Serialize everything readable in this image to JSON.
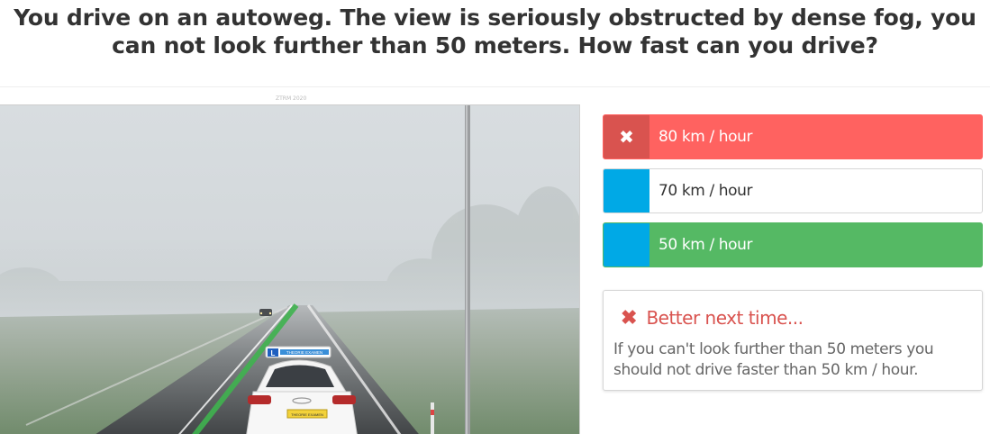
{
  "question": {
    "text": "You drive on an autoweg. The view is seriously obstructed by dense fog, you can not look further than 50 meters. How fast can you drive?"
  },
  "scene": {
    "caption": "ZTRM 2020",
    "car_sign_text": "THEORIE EXAMEN",
    "learner_plate": "L"
  },
  "answers": [
    {
      "label": "80 km / hour",
      "state": "wrong",
      "marker_icon": "close-icon"
    },
    {
      "label": "70 km / hour",
      "state": "neutral",
      "marker_icon": ""
    },
    {
      "label": "50 km / hour",
      "state": "correct",
      "marker_icon": ""
    }
  ],
  "feedback": {
    "icon": "close-icon",
    "title": "Better next time...",
    "body": "If you can't look further than 50 meters you should not drive faster than 50 km / hour."
  },
  "colors": {
    "wrong": "#ff6260",
    "wrong_marker": "#d9534f",
    "correct": "#55b964",
    "marker_blue": "#00a9e6",
    "feedback_red": "#d9534f"
  }
}
